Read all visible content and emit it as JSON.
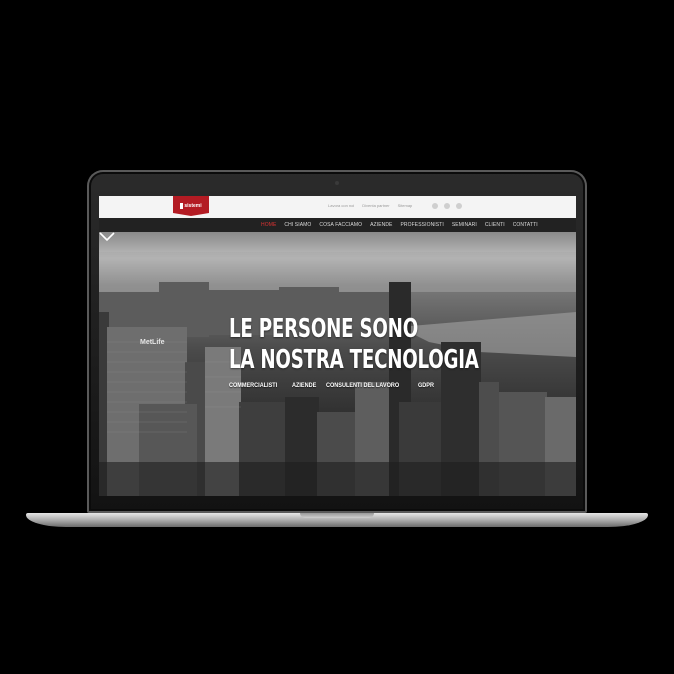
{
  "topbar": {
    "logo_text": "sistemi",
    "links": [
      "Lavora con noi",
      "Diventa partner",
      "Sitemap"
    ],
    "socials": [
      "social-icon-1",
      "social-icon-2",
      "social-icon-3"
    ]
  },
  "nav": {
    "items": [
      {
        "label": "HOME",
        "active": true
      },
      {
        "label": "CHI SIAMO",
        "active": false
      },
      {
        "label": "COSA FACCIAMO",
        "active": false
      },
      {
        "label": "AZIENDE",
        "active": false
      },
      {
        "label": "PROFESSIONISTI",
        "active": false
      },
      {
        "label": "SEMINARI",
        "active": false
      },
      {
        "label": "CLIENTI",
        "active": false
      },
      {
        "label": "CONTATTI",
        "active": false
      }
    ]
  },
  "hero": {
    "headline_line1": "LE PERSONE SONO",
    "headline_line2": "LA NOSTRA TECNOLOGIA",
    "sublinks": [
      "COMMERCIALISTI",
      "AZIENDE",
      "CONSULENTI DEL LAVORO",
      "GDPR"
    ],
    "scroll_icon": "chevron-down-icon",
    "building_sign": "MetLife"
  },
  "colors": {
    "brand_red": "#b31b23",
    "nav_bg": "#222222",
    "active_nav": "#dd3333"
  }
}
